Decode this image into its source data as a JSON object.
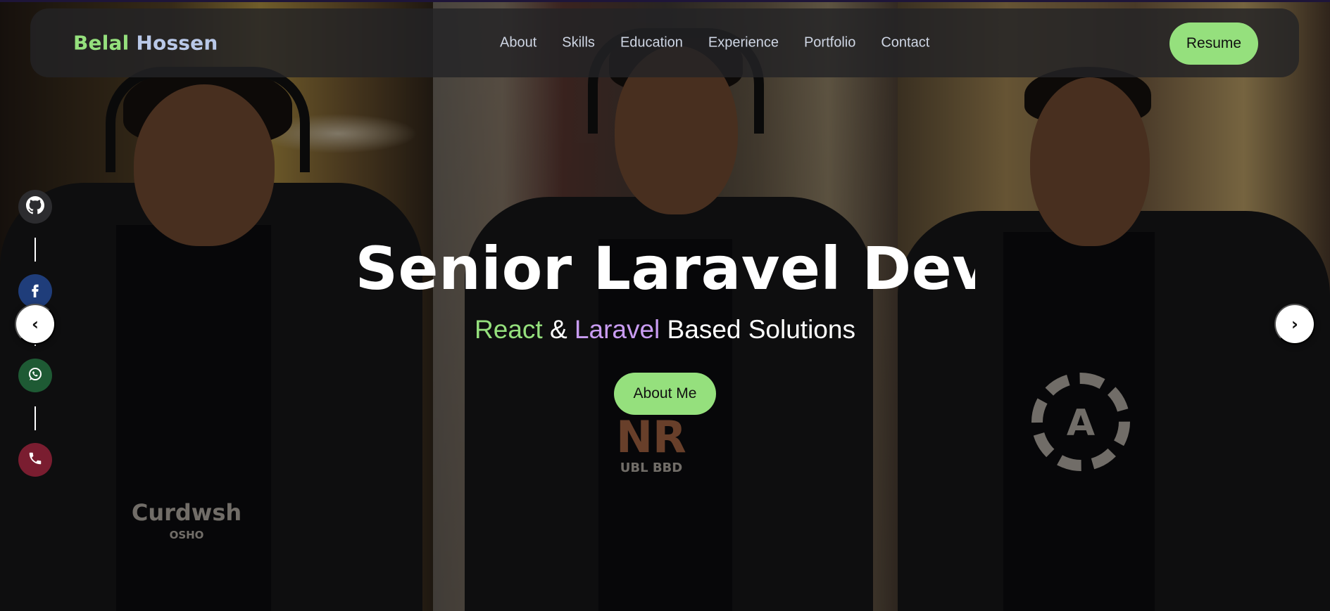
{
  "brand": {
    "first": "Belal",
    "last": "Hossen"
  },
  "nav": {
    "items": [
      {
        "label": "About"
      },
      {
        "label": "Skills"
      },
      {
        "label": "Education"
      },
      {
        "label": "Experience"
      },
      {
        "label": "Portfolio"
      },
      {
        "label": "Contact"
      }
    ],
    "resume_label": "Resume"
  },
  "hero": {
    "title": "Senior Laravel Developer",
    "subtitle": {
      "react": "React",
      "amp": " & ",
      "laravel": "Laravel",
      "rest": " Based Solutions"
    },
    "cta_label": "About Me"
  },
  "social": [
    {
      "name": "github",
      "icon": "github-icon",
      "color": "#2c2c2f"
    },
    {
      "name": "facebook",
      "icon": "facebook-icon",
      "color": "#1f3d7a"
    },
    {
      "name": "whatsapp",
      "icon": "whatsapp-icon",
      "color": "#1e5a34"
    },
    {
      "name": "phone",
      "icon": "phone-icon",
      "color": "#7a1d30"
    }
  ],
  "carousel": {
    "prev_glyph": "‹",
    "next_glyph": "›"
  },
  "shirt_prints": {
    "left": "Curdwsh",
    "left_small": "OSHO",
    "middle": "NR",
    "middle_small": "UBL BBD",
    "right": "A"
  },
  "colors": {
    "accent_green": "#95e07d",
    "accent_purple": "#c99cf2",
    "nav_text": "#cfd6e4"
  }
}
